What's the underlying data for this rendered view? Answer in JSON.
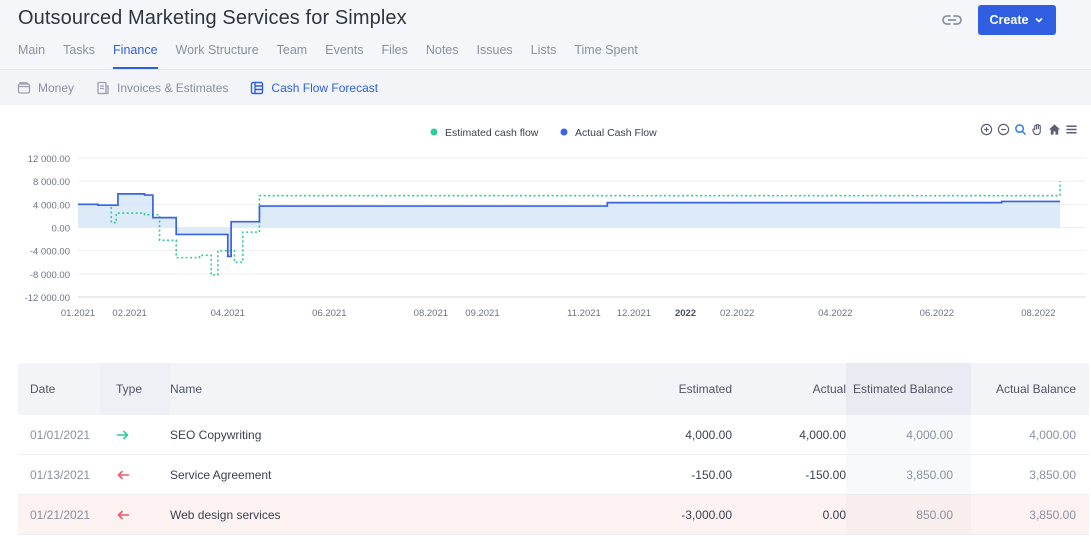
{
  "header": {
    "title": "Outsourced Marketing Services for Simplex",
    "create_label": "Create"
  },
  "tabs": [
    "Main",
    "Tasks",
    "Finance",
    "Work Structure",
    "Team",
    "Events",
    "Files",
    "Notes",
    "Issues",
    "Lists",
    "Time Spent"
  ],
  "active_tab": "Finance",
  "subnav": {
    "money": "Money",
    "invoices": "Invoices & Estimates",
    "cashflow": "Cash Flow Forecast"
  },
  "colors": {
    "accent": "#2f5fe0",
    "estimated": "#2ecc9a",
    "actual": "#3a63e0",
    "incoming": "#2ecc9a",
    "outgoing": "#ef5b6b"
  },
  "chart_data": {
    "type": "line",
    "legend": [
      "Estimated cash flow",
      "Actual Cash Flow"
    ],
    "legend_position": "top-center",
    "ylim": [
      -12000,
      12000
    ],
    "yticks": [
      "12 000.00",
      "8 000.00",
      "4 000.00",
      "0.00",
      "-4 000.00",
      "-8 000.00",
      "-12 000.00"
    ],
    "ytick_values": [
      12000,
      8000,
      4000,
      0,
      -4000,
      -8000,
      -12000
    ],
    "xlim": [
      "2021-01-01",
      "2022-08-20"
    ],
    "xticks": [
      {
        "date": "2021-01-01",
        "label": "01.2021",
        "bold": false
      },
      {
        "date": "2021-02-01",
        "label": "02.2021",
        "bold": false
      },
      {
        "date": "2021-04-01",
        "label": "04.2021",
        "bold": false
      },
      {
        "date": "2021-06-01",
        "label": "06.2021",
        "bold": false
      },
      {
        "date": "2021-08-01",
        "label": "08.2021",
        "bold": false
      },
      {
        "date": "2021-09-01",
        "label": "09.2021",
        "bold": false
      },
      {
        "date": "2021-11-01",
        "label": "11.2021",
        "bold": false
      },
      {
        "date": "2021-12-01",
        "label": "12.2021",
        "bold": false
      },
      {
        "date": "2022-01-01",
        "label": "2022",
        "bold": true
      },
      {
        "date": "2022-02-01",
        "label": "02.2022",
        "bold": false
      },
      {
        "date": "2022-04-01",
        "label": "04.2022",
        "bold": false
      },
      {
        "date": "2022-06-01",
        "label": "06.2022",
        "bold": false
      },
      {
        "date": "2022-08-01",
        "label": "08.2022",
        "bold": false
      }
    ],
    "grid": true,
    "series": [
      {
        "name": "Estimated cash flow",
        "style": "dotted-step",
        "points": [
          [
            "2021-01-01",
            4000
          ],
          [
            "2021-01-13",
            3850
          ],
          [
            "2021-01-21",
            850
          ],
          [
            "2021-01-24",
            2500
          ],
          [
            "2021-02-10",
            2200
          ],
          [
            "2021-02-19",
            -2200
          ],
          [
            "2021-03-01",
            -5200
          ],
          [
            "2021-03-15",
            -4800
          ],
          [
            "2021-03-22",
            -8200
          ],
          [
            "2021-03-26",
            -4000
          ],
          [
            "2021-04-05",
            -6000
          ],
          [
            "2021-04-10",
            -800
          ],
          [
            "2021-04-20",
            5500
          ],
          [
            "2022-08-10",
            5500
          ],
          [
            "2022-08-14",
            8000
          ]
        ]
      },
      {
        "name": "Actual Cash Flow",
        "style": "solid-step",
        "points": [
          [
            "2021-01-01",
            4000
          ],
          [
            "2021-01-13",
            3850
          ],
          [
            "2021-01-25",
            5800
          ],
          [
            "2021-02-10",
            5600
          ],
          [
            "2021-02-15",
            1700
          ],
          [
            "2021-03-01",
            -1200
          ],
          [
            "2021-04-01",
            -5000
          ],
          [
            "2021-04-03",
            1000
          ],
          [
            "2021-04-20",
            3700
          ],
          [
            "2021-11-15",
            4300
          ],
          [
            "2022-07-10",
            4500
          ],
          [
            "2022-08-14",
            4500
          ]
        ]
      }
    ]
  },
  "table": {
    "headers": {
      "date": "Date",
      "type": "Type",
      "name": "Name",
      "estimated": "Estimated",
      "actual": "Actual",
      "estimated_balance": "Estimated Balance",
      "actual_balance": "Actual Balance"
    },
    "rows": [
      {
        "date": "01/01/2021",
        "direction": "in",
        "name": "SEO Copywriting",
        "estimated": "4,000.00",
        "actual": "4,000.00",
        "estimated_balance": "4,000.00",
        "actual_balance": "4,000.00"
      },
      {
        "date": "01/13/2021",
        "direction": "out",
        "name": "Service Agreement",
        "estimated": "-150.00",
        "actual": "-150.00",
        "estimated_balance": "3,850.00",
        "actual_balance": "3,850.00"
      },
      {
        "date": "01/21/2021",
        "direction": "out",
        "name": "Web design services",
        "estimated": "-3,000.00",
        "actual": "0.00",
        "estimated_balance": "850.00",
        "actual_balance": "3,850.00"
      }
    ]
  }
}
